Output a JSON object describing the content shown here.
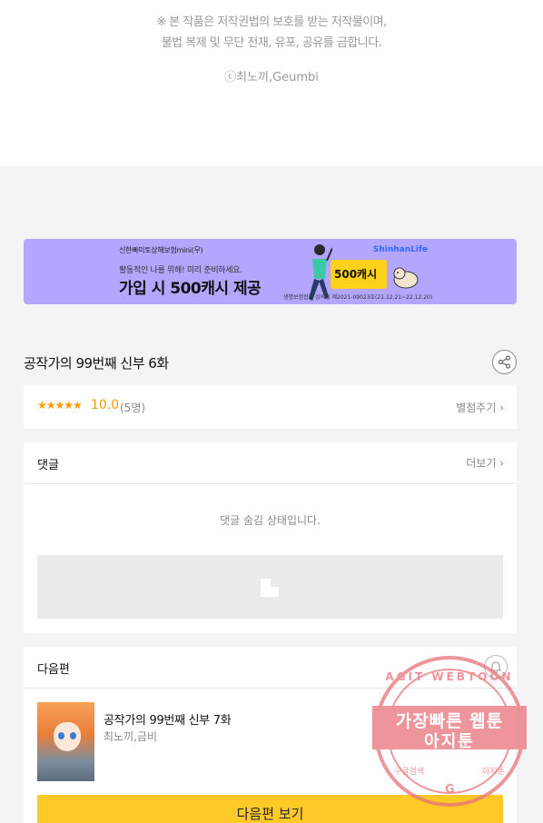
{
  "notice": {
    "line1": "※ 본 작품은 저작권법의 보호를 받는 저작물이며,",
    "line2": "불법 복제 및 무단 전재, 유포, 공유를 금합니다.",
    "copyright": "ⓒ최노끼,Geumbi"
  },
  "ad": {
    "product": "신한빠미토상해보험mini(무)",
    "subtitle": "활동적인 나를 위해! 미리 준비하세요.",
    "headline": "가입 시 500캐시 제공",
    "brand": "ShinhanLife",
    "badge": "500캐시",
    "fine_print": "생명보험협회 심의필 제2021-09023호(21.12.21~22.12.20)"
  },
  "episode": {
    "title": "공작가의 99번째 신부 6화"
  },
  "rating": {
    "stars": "★★★★★",
    "score": "10.0",
    "count": "(5명)",
    "rate_label": "별점주기 ›"
  },
  "comments": {
    "label": "댓글",
    "more_label": "더보기 ›",
    "hidden_message": "댓글 숨김 상태입니다."
  },
  "next_episode": {
    "label": "다음편",
    "title": "공작가의 99번째 신부 7화",
    "authors": "최노끼,금비",
    "button_label": "다음편 보기"
  },
  "watermark": {
    "arc_text": "AGIT WEBTOON",
    "line1": "가장빠른 웹툰",
    "line2": "아지툰",
    "bottom_left": "구글검색",
    "bottom_right": "아지툰",
    "g": "G"
  },
  "colors": {
    "accent": "#ffca28",
    "rating": "#ff9900",
    "ad_bg": "#b4a6ff",
    "watermark": "#e8727a"
  }
}
